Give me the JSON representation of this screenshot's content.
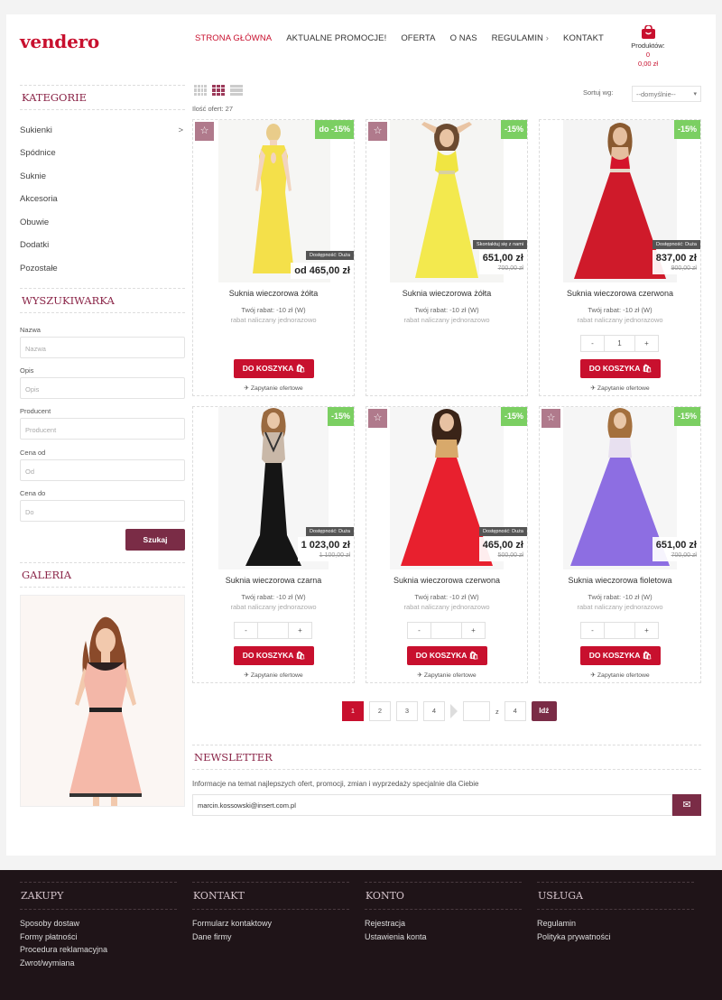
{
  "header": {
    "logo": "vendero",
    "nav": [
      {
        "label": "STRONA GŁÓWNA"
      },
      {
        "label": "AKTUALNE PROMOCJE!"
      },
      {
        "label": "OFERTA"
      },
      {
        "label": "O NAS"
      },
      {
        "label": "REGULAMIN"
      },
      {
        "label": "KONTAKT"
      }
    ],
    "cart": {
      "label": "Produktów:",
      "count": "0",
      "total": "0,00 zł"
    }
  },
  "sidebar": {
    "categories_title": "KATEGORIE",
    "categories": [
      "Sukienki",
      "Spódnice",
      "Suknie",
      "Akcesoria",
      "Obuwie",
      "Dodatki",
      "Pozostałe"
    ],
    "categories_arrow": ">",
    "search_title": "WYSZUKIWARKA",
    "fields": [
      {
        "label": "Nazwa",
        "placeholder": "Nazwa"
      },
      {
        "label": "Opis",
        "placeholder": "Opis"
      },
      {
        "label": "Producent",
        "placeholder": "Producent"
      },
      {
        "label": "Cena od",
        "placeholder": "Od"
      },
      {
        "label": "Cena do",
        "placeholder": "Do"
      }
    ],
    "search_button": "Szukaj",
    "gallery_title": "GALERIA"
  },
  "listing": {
    "count_text": "Ilość ofert: 27",
    "sort_label": "Sortuj wg:",
    "sort_value": "--domyślnie--",
    "discount_note": "rabat naliczany jednorazowo",
    "add_to_cart": "DO KOSZYKA",
    "ask_offer": "Zapytanie ofertowe",
    "products": [
      {
        "name": "Suknia wieczorowa żółta",
        "discount": "do -15%",
        "avail": "Dostępność: Duża",
        "price": "od 465,00 zł",
        "old_price": "",
        "rabat": "Twój rabat: -10 zł (W)",
        "qty": ""
      },
      {
        "name": "Suknia wieczorowa żółta",
        "discount": "-15%",
        "avail": "Skontaktuj się z nami",
        "price": "651,00 zł",
        "old_price": "700,00 zł",
        "rabat": "Twój rabat: -10 zł (W)",
        "qty": ""
      },
      {
        "name": "Suknia wieczorowa czerwona",
        "discount": "-15%",
        "avail": "Dostępność: Duża",
        "price": "837,00 zł",
        "old_price": "900,00 zł",
        "rabat": "Twój rabat: -10 zł (W)",
        "qty": "1"
      },
      {
        "name": "Suknia wieczorowa czarna",
        "discount": "-15%",
        "avail": "Dostępność: Duża",
        "price": "1 023,00 zł",
        "old_price": "1 100,00 zł",
        "rabat": "Twój rabat: -10 zł (W)",
        "qty": ""
      },
      {
        "name": "Suknia wieczorowa czerwona",
        "discount": "-15%",
        "avail": "Dostępność: Duża",
        "price": "465,00 zł",
        "old_price": "500,00 zł",
        "rabat": "Twój rabat: -10 zł (W)",
        "qty": ""
      },
      {
        "name": "Suknia wieczorowa fioletowa",
        "discount": "-15%",
        "avail": "",
        "price": "651,00 zł",
        "old_price": "700,00 zł",
        "rabat": "Twój rabat: -10 zł (W)",
        "qty": ""
      }
    ],
    "qty_minus": "-",
    "qty_plus": "+"
  },
  "pagination": {
    "pages": [
      "1",
      "2",
      "3",
      "4"
    ],
    "of_label": "z",
    "total": "4",
    "go": "Idź"
  },
  "newsletter": {
    "title": "NEWSLETTER",
    "text": "Informacje na temat najlepszych ofert, promocji, zmian i wyprzedaży specjalnie dla Ciebie",
    "email": "marcin.kossowski@insert.com.pl"
  },
  "footer": {
    "cols": [
      {
        "title": "ZAKUPY",
        "links": [
          "Sposoby dostaw",
          "Formy płatności",
          "Procedura reklamacyjna",
          "Zwrot/wymiana"
        ]
      },
      {
        "title": "KONTAKT",
        "links": [
          "Formularz kontaktowy",
          "Dane firmy"
        ]
      },
      {
        "title": "KONTO",
        "links": [
          "Rejestracja",
          "Ustawienia konta"
        ]
      },
      {
        "title": "USŁUGA",
        "links": [
          "Regulamin",
          "Polityka prywatności"
        ]
      }
    ]
  },
  "icons": {
    "star": "star-icon",
    "cart": "shopping-bag-icon",
    "mail": "envelope-icon",
    "plane": "paper-plane-icon"
  },
  "colors": {
    "brand": "#c8102e",
    "accent": "#7a2c46",
    "discount": "#7bcf62",
    "footer": "#1f1418"
  }
}
